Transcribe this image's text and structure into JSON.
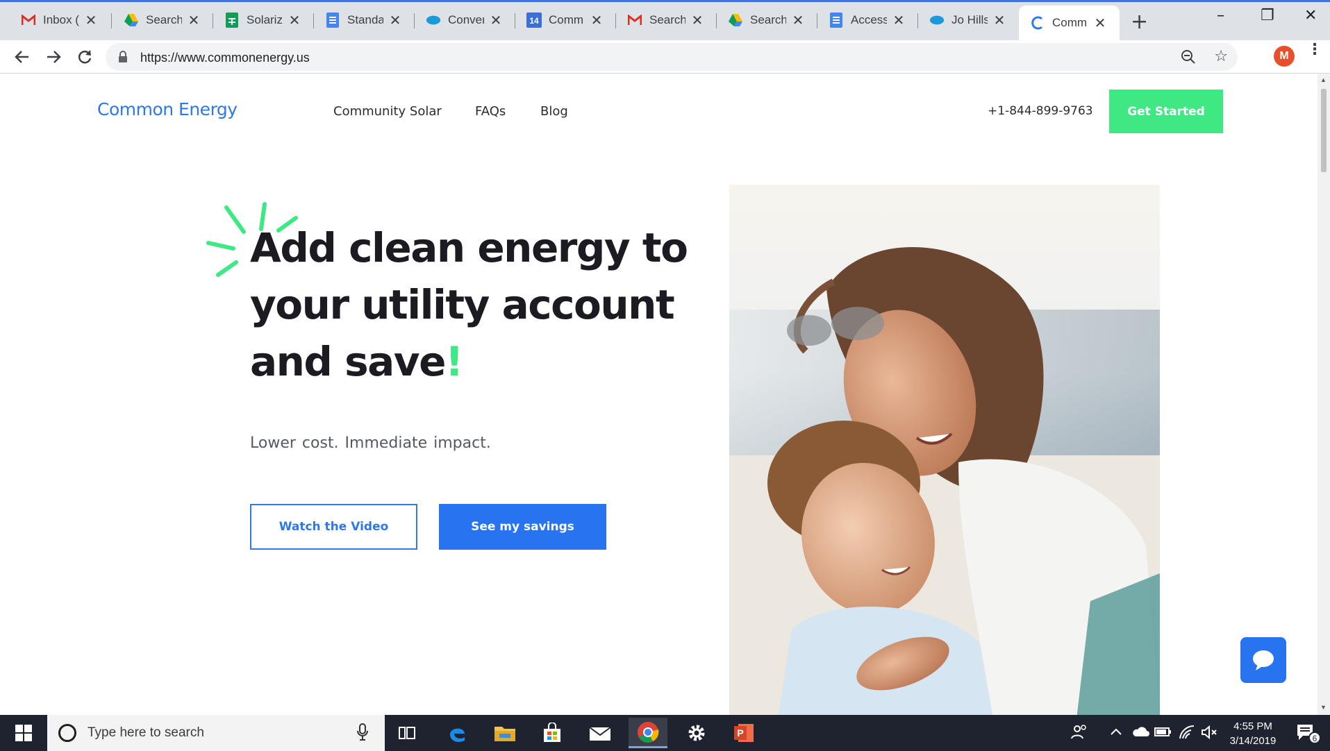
{
  "browser": {
    "tabs": [
      {
        "title": "Inbox (",
        "icon": "gmail-icon",
        "color": "#d93025"
      },
      {
        "title": "Search",
        "icon": "google-drive-icon",
        "color": "#fbbc04"
      },
      {
        "title": "Solariz",
        "icon": "google-sheets-icon",
        "color": "#0f9d58"
      },
      {
        "title": "Standa",
        "icon": "google-docs-icon",
        "color": "#4285f4"
      },
      {
        "title": "Conver",
        "icon": "salesforce-icon",
        "color": "#1a9ad9"
      },
      {
        "title": "Comm",
        "icon": "calendar-icon",
        "color": "#3b6fd8",
        "badge": "14"
      },
      {
        "title": "Search",
        "icon": "gmail-icon",
        "color": "#d93025"
      },
      {
        "title": "Search",
        "icon": "google-drive-icon",
        "color": "#fbbc04"
      },
      {
        "title": "Access",
        "icon": "google-docs-icon",
        "color": "#4285f4"
      },
      {
        "title": "Jo Hills",
        "icon": "salesforce-icon",
        "color": "#1a9ad9"
      },
      {
        "title": "Comm",
        "icon": "common-energy-icon",
        "color": "#2f78e8",
        "active": true
      }
    ],
    "close_glyph": "✕",
    "new_tab_glyph": "+",
    "url": "https://www.commonenergy.us",
    "profile_initial": "M"
  },
  "site": {
    "logo": "Common Energy",
    "nav": [
      "Community Solar",
      "FAQs",
      "Blog"
    ],
    "phone": "+1-844-899-9763",
    "cta": "Get Started",
    "hero_title_main": "Add clean energy to your utility account and save",
    "hero_title_bang": "!",
    "hero_sub": "Lower cost.  Immediate impact.",
    "btn_video": "Watch the Video",
    "btn_savings": "See my savings",
    "accent_green": "#3ee882",
    "accent_blue": "#2874f0"
  },
  "taskbar": {
    "search_placeholder": "Type here to search",
    "time": "4:55 PM",
    "date": "3/14/2019",
    "notification_count": "6"
  }
}
